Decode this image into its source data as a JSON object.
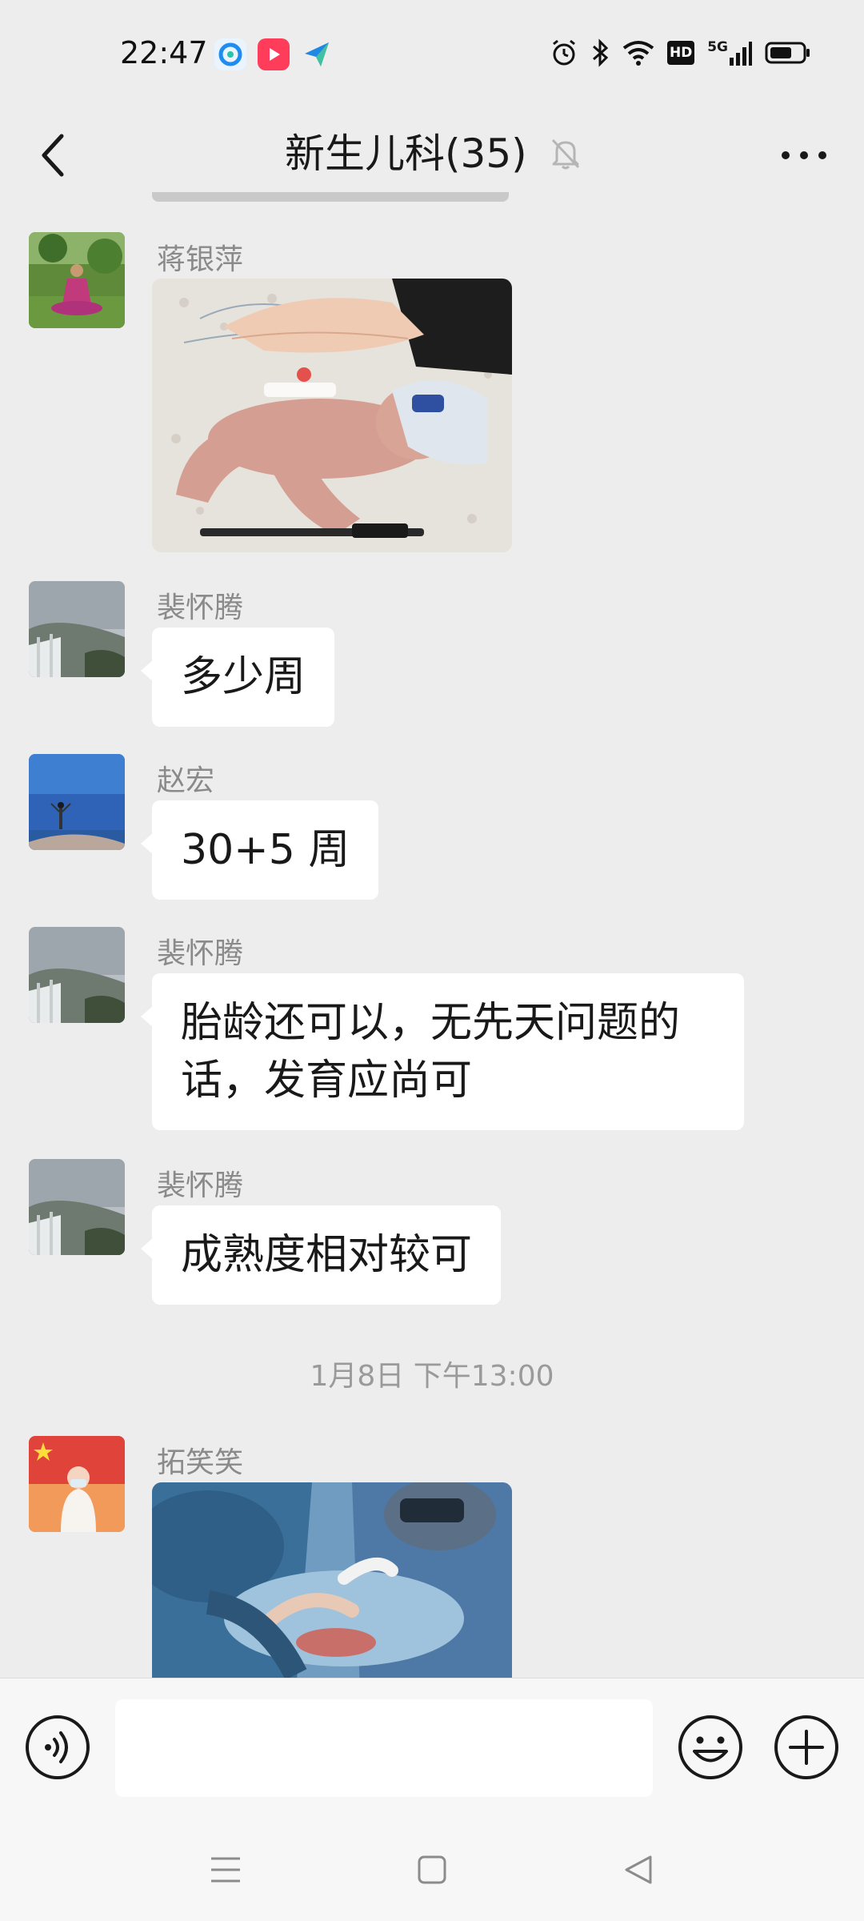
{
  "status_bar": {
    "time": "22:47",
    "network": "5G",
    "hd_label": "HD",
    "icons": [
      "qq-browser-icon",
      "video-app-icon",
      "send-app-icon",
      "alarm-icon",
      "bluetooth-icon",
      "wifi-icon",
      "hd-icon",
      "signal-icon",
      "battery-icon"
    ],
    "battery_level": 0.6
  },
  "header": {
    "title": "新生儿科(35)",
    "back_icon": "chevron-left-icon",
    "mute_icon": "bell-muted-icon",
    "more_icon": "more-dots-icon"
  },
  "messages": [
    {
      "sender": "蒋银萍",
      "type": "image",
      "image_desc": "premature-infant-photo"
    },
    {
      "sender": "裴怀腾",
      "type": "text",
      "text": "多少周"
    },
    {
      "sender": "赵宏",
      "type": "text",
      "text": "30+5 周"
    },
    {
      "sender": "裴怀腾",
      "type": "text",
      "lines": [
        "胎龄还可以，无先天问题的",
        "话，发育应尚可"
      ]
    },
    {
      "sender": "裴怀腾",
      "type": "text",
      "text": "成熟度相对较可"
    },
    {
      "sender": "拓笑笑",
      "type": "image",
      "image_desc": "surgery-photo"
    }
  ],
  "timestamp": "1月8日 下午13:00",
  "input": {
    "value": "",
    "placeholder": ""
  },
  "colors": {
    "background": "#ededed",
    "bubble": "#ffffff",
    "sender_text": "#8a8a8a"
  }
}
